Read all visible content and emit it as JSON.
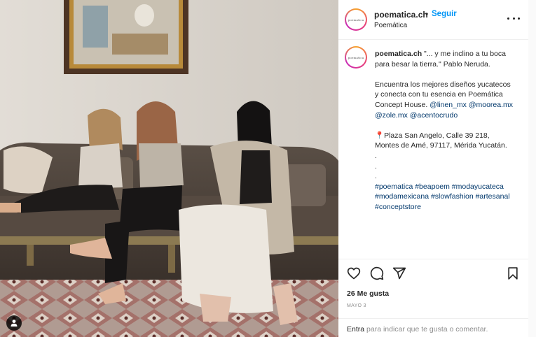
{
  "post": {
    "username": "poematica.ch",
    "dot": "•",
    "follow_label": "Seguir",
    "subtitle": "Poemática",
    "avatar_text": "poematica",
    "photo": {
      "icon": "user-tag-icon",
      "colors": {
        "wall": "#d9d3cb",
        "sofa": "#4a4038",
        "floor": "#a8948a"
      }
    },
    "caption": {
      "username": "poematica.ch",
      "line1": "\"... y me inclino a tu boca para besar la tierra.\" Pablo Neruda.",
      "line2": "Encuentra los mejores diseños yucatecos y conecta con tu esencia en Poemática Concept House.",
      "mention1": "@linen_mx",
      "mention2": "@moorea.mx",
      "mention3": "@zole.mx",
      "mention4": "@acentocrudo",
      "location": "📍Plaza San Angelo, Calle 39 218, Montes de Amé, 97117, Mérida Yucatán.",
      "dot1": ".",
      "dot2": ".",
      "dot3": ".",
      "tags": [
        "#poematica",
        "#beapoem",
        "#modayucateca",
        "#modamexicana",
        "#slowfashion",
        "#artesanal",
        "#conceptstore"
      ]
    },
    "actions": {
      "like_icon": "heart-icon",
      "comment_icon": "comment-icon",
      "share_icon": "share-icon",
      "save_icon": "bookmark-icon"
    },
    "likes": "26 Me gusta",
    "date": "MAYO 3",
    "login": {
      "link": "Entra",
      "text": "para indicar que te gusta o comentar."
    }
  }
}
